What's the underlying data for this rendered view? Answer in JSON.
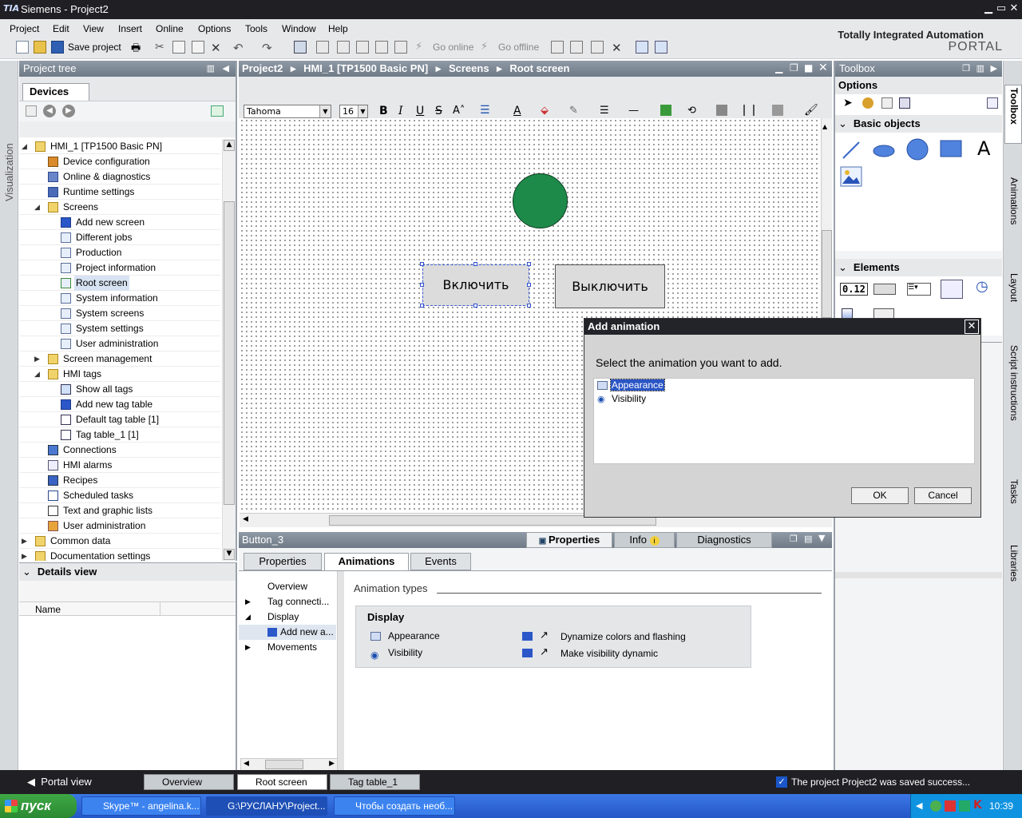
{
  "window": {
    "title": "Siemens  -  Project2",
    "logo": "TIA"
  },
  "menu": [
    "Project",
    "Edit",
    "View",
    "Insert",
    "Online",
    "Options",
    "Tools",
    "Window",
    "Help"
  ],
  "toolbar": {
    "save_label": "Save project",
    "go_online": "Go online",
    "go_offline": "Go offline"
  },
  "brand": {
    "line1": "Totally Integrated Automation",
    "line2": "PORTAL"
  },
  "left_strip": {
    "label": "Visualization"
  },
  "project_tree": {
    "title": "Project tree",
    "tab": "Devices",
    "items": [
      {
        "label": "HMI_1 [TP1500 Basic PN]",
        "level": 0,
        "expand": "open",
        "icon": "folder-icon"
      },
      {
        "label": "Device configuration",
        "level": 1,
        "icon": "device-config-icon"
      },
      {
        "label": "Online & diagnostics",
        "level": 1,
        "icon": "diagnostics-icon"
      },
      {
        "label": "Runtime settings",
        "level": 1,
        "icon": "runtime-settings-icon"
      },
      {
        "label": "Screens",
        "level": 1,
        "expand": "open",
        "icon": "folder-icon"
      },
      {
        "label": "Add new screen",
        "level": 2,
        "icon": "add-new-icon"
      },
      {
        "label": "Different jobs",
        "level": 2,
        "icon": "screen-icon"
      },
      {
        "label": "Production",
        "level": 2,
        "icon": "screen-icon"
      },
      {
        "label": "Project information",
        "level": 2,
        "icon": "screen-icon"
      },
      {
        "label": "Root screen",
        "level": 2,
        "icon": "root-screen-icon",
        "selected": true
      },
      {
        "label": "System information",
        "level": 2,
        "icon": "screen-icon"
      },
      {
        "label": "System screens",
        "level": 2,
        "icon": "screen-icon"
      },
      {
        "label": "System settings",
        "level": 2,
        "icon": "screen-icon"
      },
      {
        "label": "User administration",
        "level": 2,
        "icon": "screen-icon"
      },
      {
        "label": "Screen management",
        "level": 1,
        "expand": "closed",
        "icon": "folder-icon"
      },
      {
        "label": "HMI tags",
        "level": 1,
        "expand": "open",
        "icon": "folder-icon"
      },
      {
        "label": "Show all tags",
        "level": 2,
        "icon": "tags-icon"
      },
      {
        "label": "Add new tag table",
        "level": 2,
        "icon": "add-new-icon"
      },
      {
        "label": "Default tag table [1]",
        "level": 2,
        "icon": "tag-table-icon"
      },
      {
        "label": "Tag table_1 [1]",
        "level": 2,
        "icon": "tag-table-icon"
      },
      {
        "label": "Connections",
        "level": 1,
        "icon": "connections-icon"
      },
      {
        "label": "HMI alarms",
        "level": 1,
        "icon": "alarms-icon"
      },
      {
        "label": "Recipes",
        "level": 1,
        "icon": "recipes-icon"
      },
      {
        "label": "Scheduled tasks",
        "level": 1,
        "icon": "scheduled-tasks-icon"
      },
      {
        "label": "Text and graphic lists",
        "level": 1,
        "icon": "text-lists-icon"
      },
      {
        "label": "User administration",
        "level": 1,
        "icon": "user-admin-icon"
      },
      {
        "label": "Common data",
        "level": 0,
        "expand": "closed",
        "icon": "folder-icon"
      },
      {
        "label": "Documentation settings",
        "level": 0,
        "expand": "closed",
        "icon": "folder-icon"
      }
    ]
  },
  "details_view": {
    "title": "Details view",
    "col_name": "Name"
  },
  "editor": {
    "breadcrumb": [
      "Project2",
      "HMI_1 [TP1500 Basic PN]",
      "Screens",
      "Root screen"
    ],
    "font": "Tahoma",
    "font_size": "16",
    "buttons": {
      "on": "Включить",
      "off": "Выключить"
    }
  },
  "dialog": {
    "title": "Add animation",
    "prompt": "Select the animation you want to add.",
    "options": [
      {
        "label": "Appearance",
        "selected": true
      },
      {
        "label": "Visibility",
        "selected": false
      }
    ],
    "ok": "OK",
    "cancel": "Cancel"
  },
  "inspector": {
    "object": "Button_3",
    "top_tabs": {
      "properties": "Properties",
      "info": "Info",
      "diagnostics": "Diagnostics"
    },
    "tabs": [
      "Properties",
      "Animations",
      "Events"
    ],
    "active_tab": "Animations",
    "nav": [
      {
        "label": "Overview",
        "arrow": ""
      },
      {
        "label": "Tag connecti...",
        "arrow": "closed"
      },
      {
        "label": "Display",
        "arrow": "open"
      },
      {
        "label": "Add new a...",
        "arrow": "",
        "child": true
      },
      {
        "label": "Movements",
        "arrow": "closed"
      }
    ],
    "section_title": "Animation types",
    "group_title": "Display",
    "rows": [
      {
        "name": "Appearance",
        "action": "Dynamize colors and flashing"
      },
      {
        "name": "Visibility",
        "action": "Make visibility dynamic"
      }
    ]
  },
  "toolbox": {
    "title": "Toolbox",
    "options": "Options",
    "basic_objects": "Basic objects",
    "elements": "Elements",
    "element_sample": "0.12"
  },
  "right_strip": [
    "Toolbox",
    "Animations",
    "Layout",
    "Script instructions",
    "Tasks",
    "Libraries"
  ],
  "portal_bar": {
    "portal_view": "Portal view",
    "tabs": [
      "Overview",
      "Root screen",
      "Tag table_1"
    ],
    "status": "The project Project2 was saved success..."
  },
  "taskbar": {
    "start": "пуск",
    "items": [
      "Skype™ - angelina.k...",
      "G:\\РУСЛАНУ\\Project...",
      "Чтобы создать необ..."
    ],
    "clock": "10:39"
  },
  "colors": {
    "circle": "#1e8a4a",
    "pane_header": "#7d8894",
    "taskbar": "#2f66d6",
    "status_ok": "#1a56c9"
  }
}
